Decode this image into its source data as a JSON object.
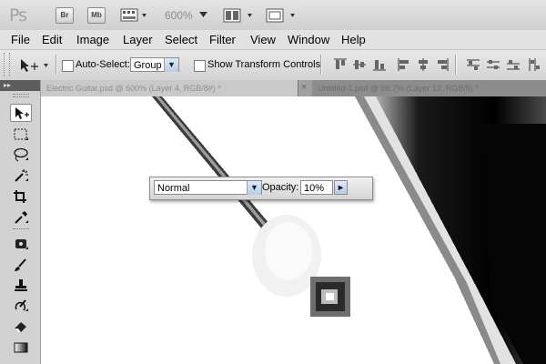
{
  "app": {
    "logo": "Ps",
    "bridge_label": "Br",
    "minibridge_label": "Mb",
    "zoom": "600%"
  },
  "menu": [
    "File",
    "Edit",
    "Image",
    "Layer",
    "Select",
    "Filter",
    "View",
    "Window",
    "Help"
  ],
  "options": {
    "auto_select_label": "Auto-Select:",
    "auto_select_value": "Group",
    "show_transform_label": "Show Transform Controls"
  },
  "tabs": [
    {
      "label": "Electric Guitar.psd @ 600% (Layer 4, RGB/8#) *"
    },
    {
      "label": "×"
    },
    {
      "label": "Untitled-1.psd @ 66.7% (Layer 13, RGB/8) *"
    }
  ],
  "brush_panel": {
    "mode": "Normal",
    "opacity_label": "Opacity:",
    "opacity_value": "10%"
  },
  "colors": {
    "accent": "#bcd0ec",
    "panel_dark": "#5d5d5d"
  }
}
